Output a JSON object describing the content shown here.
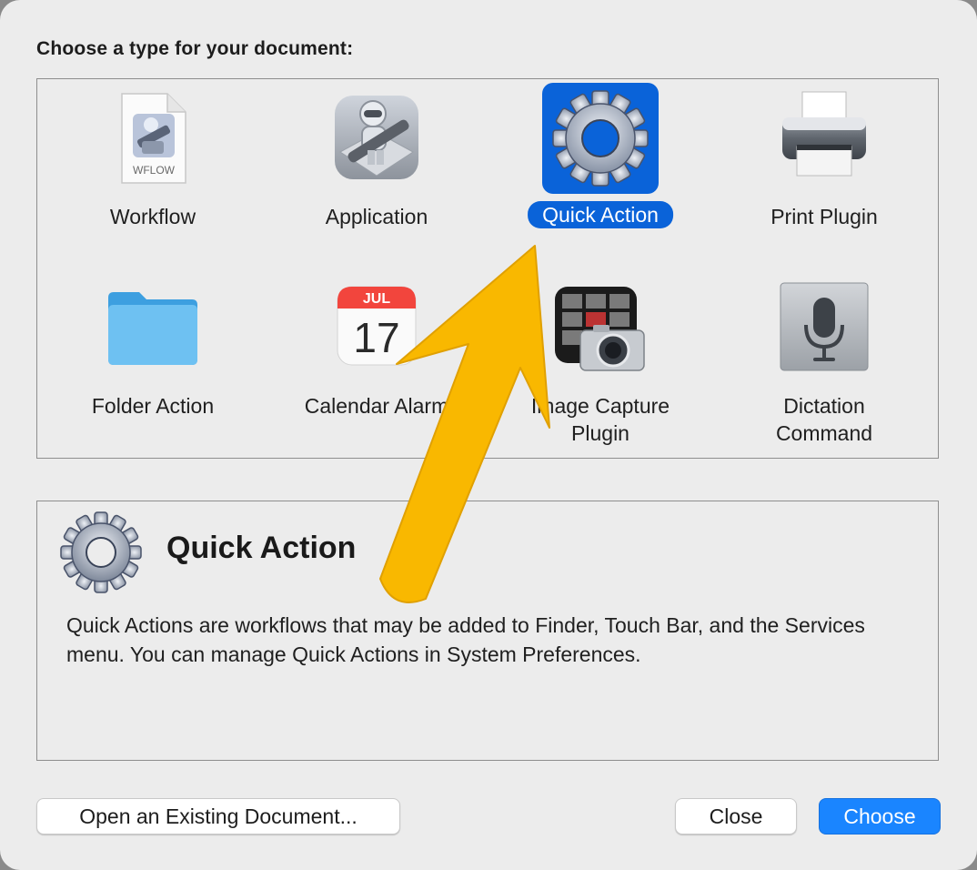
{
  "dialog": {
    "prompt": "Choose a type for your document:",
    "types": [
      {
        "label": "Workflow",
        "badge": "WFLOW",
        "icon": "workflow-document-icon"
      },
      {
        "label": "Application",
        "icon": "automator-robot-icon"
      },
      {
        "label": "Quick Action",
        "icon": "gear-icon",
        "selected": true
      },
      {
        "label": "Print Plugin",
        "icon": "printer-icon"
      },
      {
        "label": "Folder Action",
        "icon": "folder-icon"
      },
      {
        "label": "Calendar Alarm",
        "month": "JUL",
        "day": "17",
        "icon": "calendar-icon"
      },
      {
        "label_line1": "Image Capture",
        "label_line2": "Plugin",
        "icon": "image-capture-icon"
      },
      {
        "label_line1": "Dictation",
        "label_line2": "Command",
        "icon": "microphone-icon"
      }
    ],
    "detail": {
      "title": "Quick Action",
      "icon": "gear-icon",
      "description": "Quick Actions are workflows that may be added to Finder, Touch Bar, and the Services menu. You can manage Quick Actions in System Preferences."
    },
    "buttons": {
      "open_existing": "Open an Existing Document...",
      "close": "Close",
      "choose": "Choose"
    }
  },
  "colors": {
    "accent": "#1a85ff",
    "selection": "#0a63d9",
    "arrow": "#f9b800"
  }
}
